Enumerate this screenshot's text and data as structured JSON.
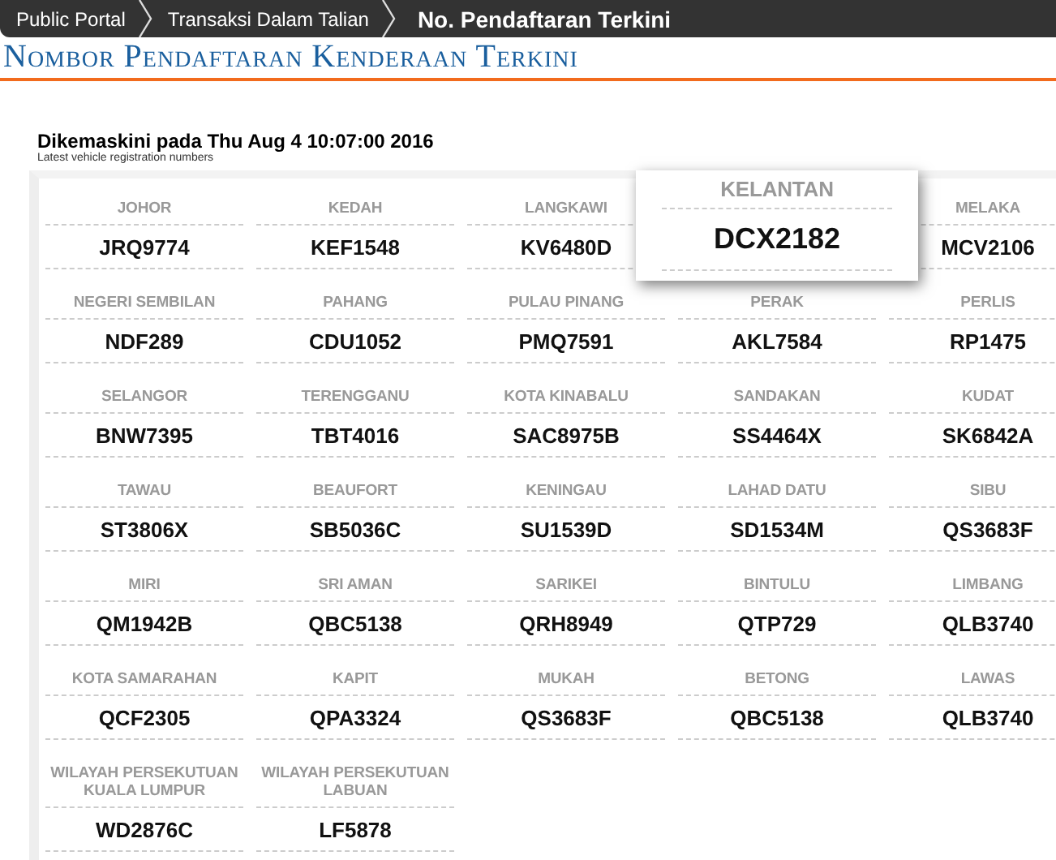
{
  "breadcrumbs": [
    {
      "label": "Public Portal",
      "selected": false
    },
    {
      "label": "Transaksi Dalam Talian",
      "selected": false
    },
    {
      "label": "No. Pendaftaran Terkini",
      "selected": true
    }
  ],
  "page_title": "Nombor Pendaftaran Kenderaan Terkini",
  "updated": "Dikemaskini pada Thu Aug 4 10:07:00 2016",
  "subtitle": "Latest vehicle registration numbers",
  "plates": [
    {
      "region": "JOHOR",
      "number": "JRQ9774",
      "selected": false
    },
    {
      "region": "KEDAH",
      "number": "KEF1548",
      "selected": false
    },
    {
      "region": "LANGKAWI",
      "number": "KV6480D",
      "selected": false
    },
    {
      "region": "KELANTAN",
      "number": "DCX2182",
      "selected": true
    },
    {
      "region": "MELAKA",
      "number": "MCV2106",
      "selected": false
    },
    {
      "region": "NEGERI SEMBILAN",
      "number": "NDF289",
      "selected": false
    },
    {
      "region": "PAHANG",
      "number": "CDU1052",
      "selected": false
    },
    {
      "region": "PULAU PINANG",
      "number": "PMQ7591",
      "selected": false
    },
    {
      "region": "PERAK",
      "number": "AKL7584",
      "selected": false
    },
    {
      "region": "PERLIS",
      "number": "RP1475",
      "selected": false
    },
    {
      "region": "SELANGOR",
      "number": "BNW7395",
      "selected": false
    },
    {
      "region": "TERENGGANU",
      "number": "TBT4016",
      "selected": false
    },
    {
      "region": "KOTA KINABALU",
      "number": "SAC8975B",
      "selected": false
    },
    {
      "region": "SANDAKAN",
      "number": "SS4464X",
      "selected": false
    },
    {
      "region": "KUDAT",
      "number": "SK6842A",
      "selected": false
    },
    {
      "region": "TAWAU",
      "number": "ST3806X",
      "selected": false
    },
    {
      "region": "BEAUFORT",
      "number": "SB5036C",
      "selected": false
    },
    {
      "region": "KENINGAU",
      "number": "SU1539D",
      "selected": false
    },
    {
      "region": "LAHAD DATU",
      "number": "SD1534M",
      "selected": false
    },
    {
      "region": "SIBU",
      "number": "QS3683F",
      "selected": false
    },
    {
      "region": "MIRI",
      "number": "QM1942B",
      "selected": false
    },
    {
      "region": "SRI AMAN",
      "number": "QBC5138",
      "selected": false
    },
    {
      "region": "SARIKEI",
      "number": "QRH8949",
      "selected": false
    },
    {
      "region": "BINTULU",
      "number": "QTP729",
      "selected": false
    },
    {
      "region": "LIMBANG",
      "number": "QLB3740",
      "selected": false
    },
    {
      "region": "KOTA SAMARAHAN",
      "number": "QCF2305",
      "selected": false
    },
    {
      "region": "KAPIT",
      "number": "QPA3324",
      "selected": false
    },
    {
      "region": "MUKAH",
      "number": "QS3683F",
      "selected": false
    },
    {
      "region": "BETONG",
      "number": "QBC5138",
      "selected": false
    },
    {
      "region": "LAWAS",
      "number": "QLB3740",
      "selected": false
    },
    {
      "region": "WILAYAH PERSEKUTUAN KUALA LUMPUR",
      "number": "WD2876C",
      "selected": false
    },
    {
      "region": "WILAYAH PERSEKUTUAN LABUAN",
      "number": "LF5878",
      "selected": false
    }
  ]
}
